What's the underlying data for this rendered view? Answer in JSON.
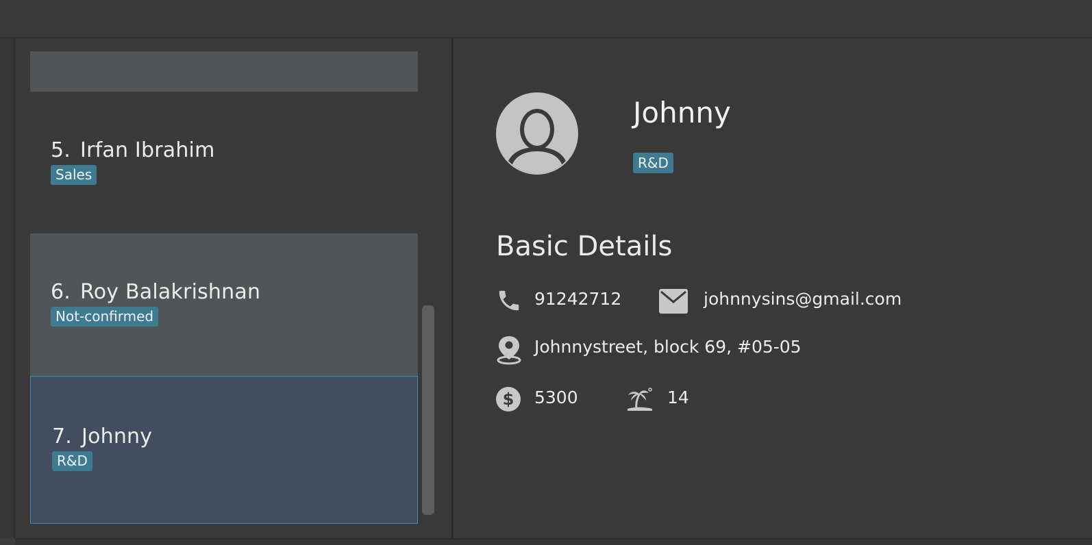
{
  "employees": [
    {
      "index": "5.",
      "name": "Irfan Ibrahim",
      "tag": "Sales"
    },
    {
      "index": "6.",
      "name": "Roy Balakrishnan",
      "tag": "Not-confirmed"
    },
    {
      "index": "7.",
      "name": "Johnny",
      "tag": "R&D"
    }
  ],
  "detail": {
    "name": "Johnny",
    "tag": "R&D",
    "section_title": "Basic Details",
    "phone": "91242712",
    "email": "johnnysins@gmail.com",
    "address": "Johnnystreet, block 69, #05-05",
    "salary": "5300",
    "leaves": "14"
  },
  "icons": {
    "phone": "phone-icon",
    "email": "envelope-icon",
    "address": "location-pin-icon",
    "salary": "dollar-icon",
    "leaves": "palm-tree-icon",
    "avatar": "user-avatar-icon"
  },
  "colors": {
    "tag_bg": "#3e7b91",
    "selected_card_bg": "#424e5f",
    "selected_card_border": "#3b8bb3",
    "panel_bg": "#393939"
  }
}
